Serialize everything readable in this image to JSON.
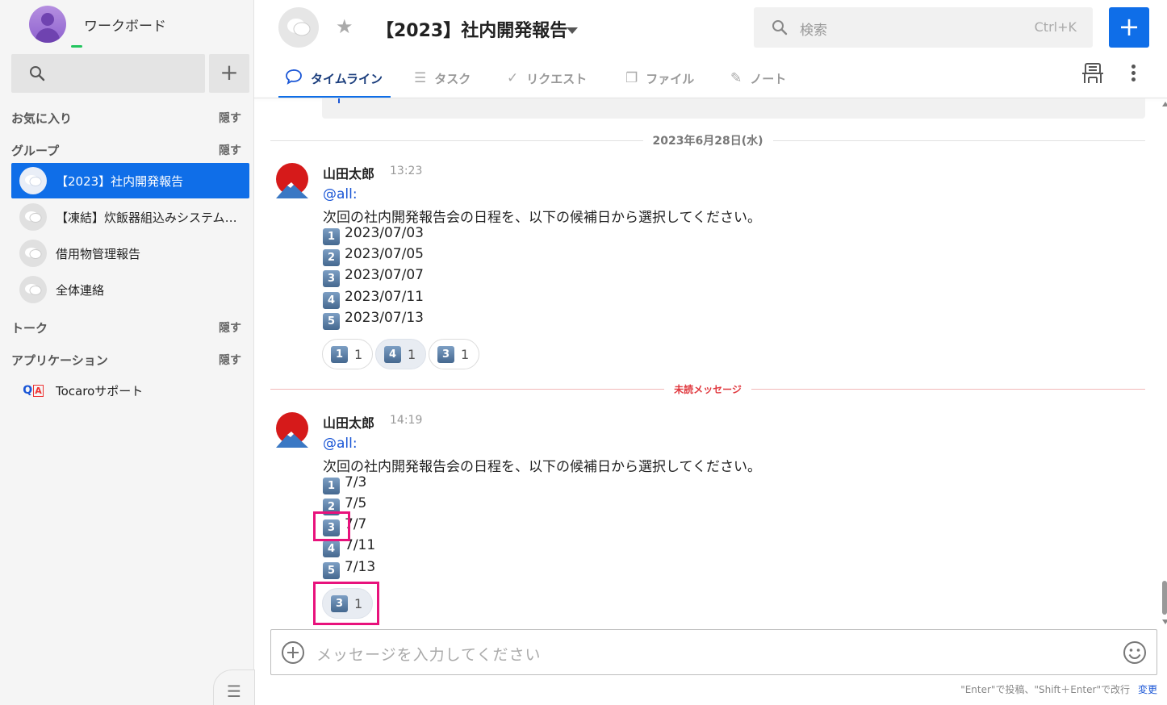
{
  "workspace": {
    "name": "ワークボード"
  },
  "sidebar": {
    "sections": {
      "favorites": {
        "label": "お気に入り",
        "hide": "隠す"
      },
      "groups": {
        "label": "グループ",
        "hide": "隠す"
      },
      "talk": {
        "label": "トーク",
        "hide": "隠す"
      },
      "apps": {
        "label": "アプリケーション",
        "hide": "隠す"
      }
    },
    "groups": [
      {
        "name": "【2023】社内開発報告",
        "active": true
      },
      {
        "name": "【凍結】炊飯器組込みシステム開発",
        "active": false
      },
      {
        "name": "借用物管理報告",
        "active": false
      },
      {
        "name": "全体連絡",
        "active": false
      }
    ],
    "apps": [
      {
        "name": "Tocaroサポート"
      }
    ]
  },
  "header": {
    "title": "【2023】社内開発報告",
    "search_placeholder": "検索",
    "search_shortcut": "Ctrl+K",
    "new_button": "+",
    "tabs": [
      {
        "label": "タイムライン",
        "icon": "chat-bubble-icon",
        "active": true
      },
      {
        "label": "タスク",
        "icon": "list-icon",
        "active": false
      },
      {
        "label": "リクエスト",
        "icon": "check-icon",
        "active": false
      },
      {
        "label": "ファイル",
        "icon": "file-icon",
        "active": false
      },
      {
        "label": "ノート",
        "icon": "edit-icon",
        "active": false
      }
    ]
  },
  "timeline": {
    "date_divider": "2023年6月28日(水)",
    "unread_divider": "未読メッセージ",
    "messages": [
      {
        "sender": "山田太郎",
        "time": "13:23",
        "mention": "@all:",
        "body": "次回の社内開発報告会の日程を、以下の候補日から選択してください。",
        "options": [
          {
            "num": "1",
            "text": "2023/07/03"
          },
          {
            "num": "2",
            "text": "2023/07/05"
          },
          {
            "num": "3",
            "text": "2023/07/07"
          },
          {
            "num": "4",
            "text": "2023/07/11"
          },
          {
            "num": "5",
            "text": "2023/07/13"
          }
        ],
        "reactions": [
          {
            "num": "1",
            "count": "1",
            "mine": false
          },
          {
            "num": "4",
            "count": "1",
            "mine": true
          },
          {
            "num": "3",
            "count": "1",
            "mine": false
          }
        ]
      },
      {
        "sender": "山田太郎",
        "time": "14:19",
        "mention": "@all:",
        "body": "次回の社内開発報告会の日程を、以下の候補日から選択してください。",
        "options": [
          {
            "num": "1",
            "text": "7/3"
          },
          {
            "num": "2",
            "text": "7/5"
          },
          {
            "num": "3",
            "text": "7/7"
          },
          {
            "num": "4",
            "text": "7/11"
          },
          {
            "num": "5",
            "text": "7/13"
          }
        ],
        "reactions": [
          {
            "num": "3",
            "count": "1",
            "mine": true
          }
        ]
      }
    ]
  },
  "composer": {
    "placeholder": "メッセージを入力してください",
    "hint": "\"Enter\"で投稿、\"Shift＋Enter\"で改行",
    "change_link": "変更"
  }
}
